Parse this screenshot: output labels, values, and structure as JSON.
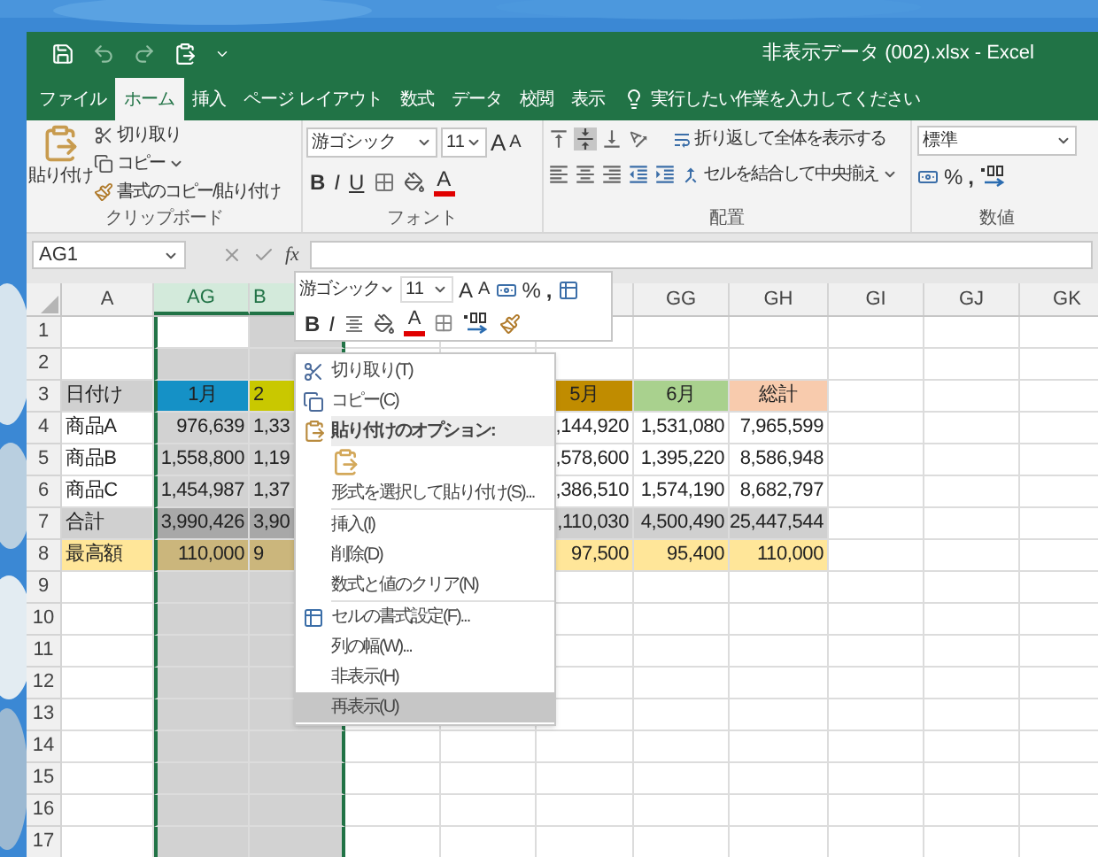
{
  "window": {
    "title": "非表示データ (002).xlsx - Excel"
  },
  "tabs": [
    {
      "label": "ファイル",
      "selected": false
    },
    {
      "label": "ホーム",
      "selected": true
    },
    {
      "label": "挿入",
      "selected": false
    },
    {
      "label": "ページ レイアウト",
      "selected": false
    },
    {
      "label": "数式",
      "selected": false
    },
    {
      "label": "データ",
      "selected": false
    },
    {
      "label": "校閲",
      "selected": false
    },
    {
      "label": "表示",
      "selected": false
    }
  ],
  "tell_me": {
    "placeholder": "実行したい作業を入力してください"
  },
  "ribbon": {
    "clipboard": {
      "paste": "貼り付け",
      "cut": "切り取り",
      "copy": "コピー",
      "format_painter": "書式のコピー/貼り付け",
      "label": "クリップボード"
    },
    "font": {
      "font_name": "游ゴシック",
      "font_size": "11",
      "grow": "A",
      "shrink": "A",
      "bold": "B",
      "italic": "I",
      "underline": "U",
      "font_color": "A",
      "label": "フォント"
    },
    "alignment": {
      "wrap_text": "折り返して全体を表示する",
      "merge_center": "セルを結合して中央揃え",
      "label": "配置"
    },
    "number": {
      "format": "標準",
      "percent": "%",
      "comma": ",",
      "label": "数値"
    }
  },
  "formula_bar": {
    "name_box": "AG1",
    "function": "fx"
  },
  "sheet": {
    "columns": [
      {
        "label": "A",
        "selected": false
      },
      {
        "label": "AG",
        "selected": true
      },
      {
        "label": "B",
        "selected": true
      },
      {
        "selected": false
      },
      {
        "selected": false
      },
      {
        "selected": false
      },
      {
        "label": "GG",
        "selected": false
      },
      {
        "label": "GH",
        "selected": false
      },
      {
        "label": "GI",
        "selected": false
      },
      {
        "label": "GJ",
        "selected": false
      },
      {
        "label": "GK",
        "selected": false
      }
    ],
    "rows": [
      {
        "number": "1",
        "kind": "data"
      },
      {
        "number": "2",
        "kind": "data"
      },
      {
        "number": "3",
        "kind": "header",
        "cells": [
          {
            "text": "日付け",
            "color": "#d0d0d0"
          },
          {
            "text": "1月",
            "color": "#1591c6"
          },
          {
            "text": "2",
            "color": "#c9c800"
          },
          {},
          {},
          {
            "text": "5月",
            "color": "#c08c00"
          },
          {
            "text": "6月",
            "color": "#a9d18e"
          },
          {
            "text": "総計",
            "color": "#f8cbad"
          },
          {},
          {},
          {}
        ]
      },
      {
        "number": "4",
        "kind": "data",
        "cells": [
          {
            "text": "商品A"
          },
          {
            "text": "976,639"
          },
          {
            "text": "1,33"
          },
          {},
          {},
          {
            "text": ",144,920"
          },
          {
            "text": "1,531,080"
          },
          {
            "text": "7,965,599"
          },
          {},
          {},
          {}
        ]
      },
      {
        "number": "5",
        "kind": "data",
        "cells": [
          {
            "text": "商品B"
          },
          {
            "text": "1,558,800"
          },
          {
            "text": "1,19"
          },
          {},
          {},
          {
            "text": ",578,600"
          },
          {
            "text": "1,395,220"
          },
          {
            "text": "8,586,948"
          },
          {},
          {},
          {}
        ]
      },
      {
        "number": "6",
        "kind": "data",
        "cells": [
          {
            "text": "商品C"
          },
          {
            "text": "1,454,987"
          },
          {
            "text": "1,37"
          },
          {},
          {},
          {
            "text": ",386,510"
          },
          {
            "text": "1,574,190"
          },
          {
            "text": "8,682,797"
          },
          {},
          {},
          {}
        ]
      },
      {
        "number": "7",
        "kind": "data",
        "cells": [
          {
            "text": "合計",
            "color": "#d0d0d0"
          },
          {
            "text": "3,990,426",
            "color": "#a8a8a8"
          },
          {
            "text": "3,90",
            "color": "#a8a8a8"
          },
          {},
          {},
          {
            "text": ",110,030",
            "color": "#d0d0d0"
          },
          {
            "text": "4,500,490",
            "color": "#d0d0d0"
          },
          {
            "text": "25,447,544",
            "color": "#d0d0d0"
          },
          {},
          {},
          {}
        ]
      },
      {
        "number": "8",
        "kind": "data",
        "cells": [
          {
            "text": "最高額",
            "color": "#ffe699"
          },
          {
            "text": "110,000",
            "color": "#cbb67c"
          },
          {
            "text": "9",
            "color": "#cbb67c"
          },
          {},
          {},
          {
            "text": "97,500",
            "color": "#ffe699"
          },
          {
            "text": "95,400",
            "color": "#ffe699"
          },
          {
            "text": "110,000",
            "color": "#ffe699"
          },
          {},
          {},
          {}
        ]
      },
      {
        "number": "9",
        "kind": "data"
      },
      {
        "number": "10",
        "kind": "data"
      },
      {
        "number": "11",
        "kind": "data"
      },
      {
        "number": "12",
        "kind": "data"
      },
      {
        "number": "13",
        "kind": "data"
      },
      {
        "number": "14",
        "kind": "data"
      },
      {
        "number": "15",
        "kind": "data"
      },
      {
        "number": "16",
        "kind": "data"
      },
      {
        "number": "17",
        "kind": "data"
      }
    ]
  },
  "mini_toolbar": {
    "font_name": "游ゴシック",
    "font_size": "11",
    "grow": "A",
    "shrink": "A",
    "percent": "%",
    "comma": ",",
    "bold": "B",
    "italic": "I",
    "font_color": "A"
  },
  "context_menu": {
    "items": [
      {
        "kind": "command",
        "label": "切り取り(T)",
        "selected": false
      },
      {
        "kind": "command",
        "label": "コピー(C)",
        "selected": false
      },
      {
        "kind": "header",
        "label": "貼り付けのオプション:",
        "selected": false
      },
      {
        "kind": "paste_options",
        "selected": false
      },
      {
        "kind": "command",
        "label": "形式を選択して貼り付け(S)...",
        "selected": false
      },
      {
        "kind": "separator"
      },
      {
        "kind": "command",
        "label": "挿入(I)",
        "selected": false
      },
      {
        "kind": "command",
        "label": "削除(D)",
        "selected": false
      },
      {
        "kind": "command",
        "label": "数式と値のクリア(N)",
        "selected": false
      },
      {
        "kind": "separator"
      },
      {
        "kind": "command",
        "label": "セルの書式設定(F)...",
        "selected": false
      },
      {
        "kind": "command",
        "label": "列の幅(W)...",
        "selected": false
      },
      {
        "kind": "command",
        "label": "非表示(H)",
        "selected": false
      },
      {
        "kind": "command",
        "label": "再表示(U)",
        "selected": true
      }
    ]
  }
}
